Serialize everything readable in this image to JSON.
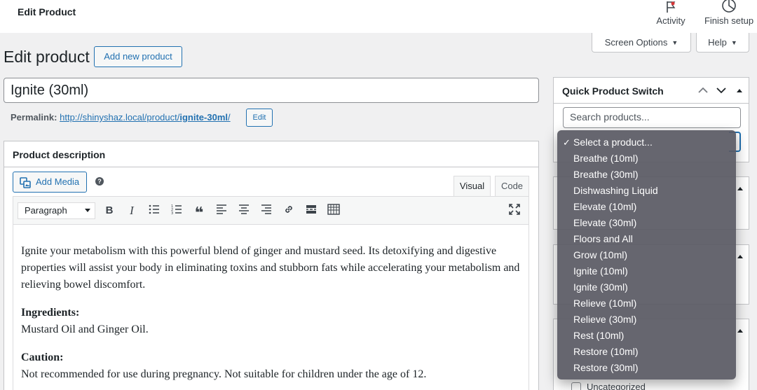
{
  "topbar": {
    "title": "Edit Product",
    "activity_label": "Activity",
    "finish_setup_label": "Finish setup"
  },
  "screen_options": {
    "label": "Screen Options",
    "help_label": "Help"
  },
  "heading": {
    "title": "Edit product",
    "add_new_label": "Add new product"
  },
  "product_title": "Ignite (30ml)",
  "permalink": {
    "label": "Permalink:",
    "url_base": "http://shinyshaz.local/product/",
    "slug": "ignite-30ml",
    "trailing": "/",
    "edit_label": "Edit"
  },
  "description_box": {
    "title": "Product description",
    "add_media_label": "Add Media",
    "tabs": [
      "Visual",
      "Code"
    ],
    "format_select": "Paragraph",
    "content": {
      "p1": "Ignite your metabolism with this powerful blend of ginger and mustard seed. Its detoxifying and digestive properties will assist your body in eliminating toxins and stubborn fats while accelerating your metabolism and relieving bowel discomfort.",
      "ingredients_heading": "Ingredients:",
      "ingredients_text": "Mustard Oil and Ginger Oil.",
      "caution_heading": "Caution:",
      "caution_text": "Not recommended for use during pregnancy. Not suitable for children under the age of 12."
    }
  },
  "quick_switch": {
    "title": "Quick Product Switch",
    "search_placeholder": "Search products...",
    "options": [
      "Select a product...",
      "Breathe (10ml)",
      "Breathe (30ml)",
      "Dishwashing Liquid",
      "Elevate (10ml)",
      "Elevate (30ml)",
      "Floors and All",
      "Grow (10ml)",
      "Ignite (10ml)",
      "Ignite (30ml)",
      "Relieve (10ml)",
      "Relieve (30ml)",
      "Rest (10ml)",
      "Restore (10ml)",
      "Restore (30ml)"
    ],
    "selected_index": 0
  },
  "categories": {
    "first_item": "Uncategorized"
  }
}
